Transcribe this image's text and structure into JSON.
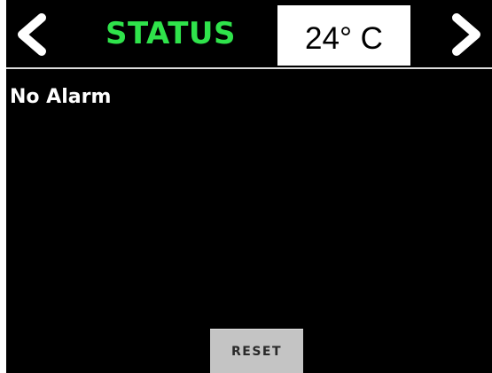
{
  "header": {
    "title": "STATUS",
    "temperature": "24° C",
    "prev_icon": "chevron-left-icon",
    "next_icon": "chevron-right-icon"
  },
  "status": {
    "alarm_text": "No Alarm"
  },
  "controls": {
    "reset_label": "RESET"
  },
  "colors": {
    "background": "#000000",
    "title": "#2fe34b",
    "temperature_box": "#ffffff",
    "text": "#ffffff",
    "button": "#c4c4c4",
    "button_text": "#2a2a2a"
  }
}
